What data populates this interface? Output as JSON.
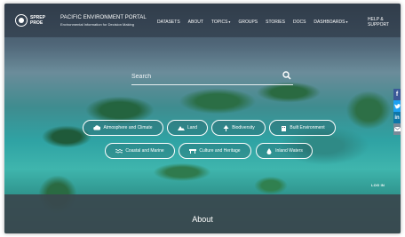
{
  "header": {
    "logo_text": "SPREP PROE",
    "brand_title": "PACIFIC ENVIRONMENT PORTAL",
    "brand_subtitle": "Environmental Information for Decision Making"
  },
  "nav": {
    "items": [
      {
        "label": "DATASETS"
      },
      {
        "label": "ABOUT"
      },
      {
        "label": "TOPICS"
      },
      {
        "label": "GROUPS"
      },
      {
        "label": "STORIES"
      },
      {
        "label": "DOCS"
      },
      {
        "label": "DASHBOARDS"
      }
    ],
    "help_label": "HELP & SUPPORT"
  },
  "search": {
    "placeholder": "Search",
    "icon": "search-icon"
  },
  "topics": [
    {
      "label": "Atmosphere and Climate",
      "icon": "cloud-icon"
    },
    {
      "label": "Land",
      "icon": "mountain-icon"
    },
    {
      "label": "Biodiversity",
      "icon": "tree-icon"
    },
    {
      "label": "Built Environment",
      "icon": "building-icon"
    },
    {
      "label": "Coastal and Marine",
      "icon": "waves-icon"
    },
    {
      "label": "Culture and Heritage",
      "icon": "heritage-icon"
    },
    {
      "label": "Inland Waters",
      "icon": "droplet-icon"
    }
  ],
  "social": [
    "f",
    "t",
    "in",
    "mail"
  ],
  "login_label": "LOG IN",
  "about_label": "About"
}
